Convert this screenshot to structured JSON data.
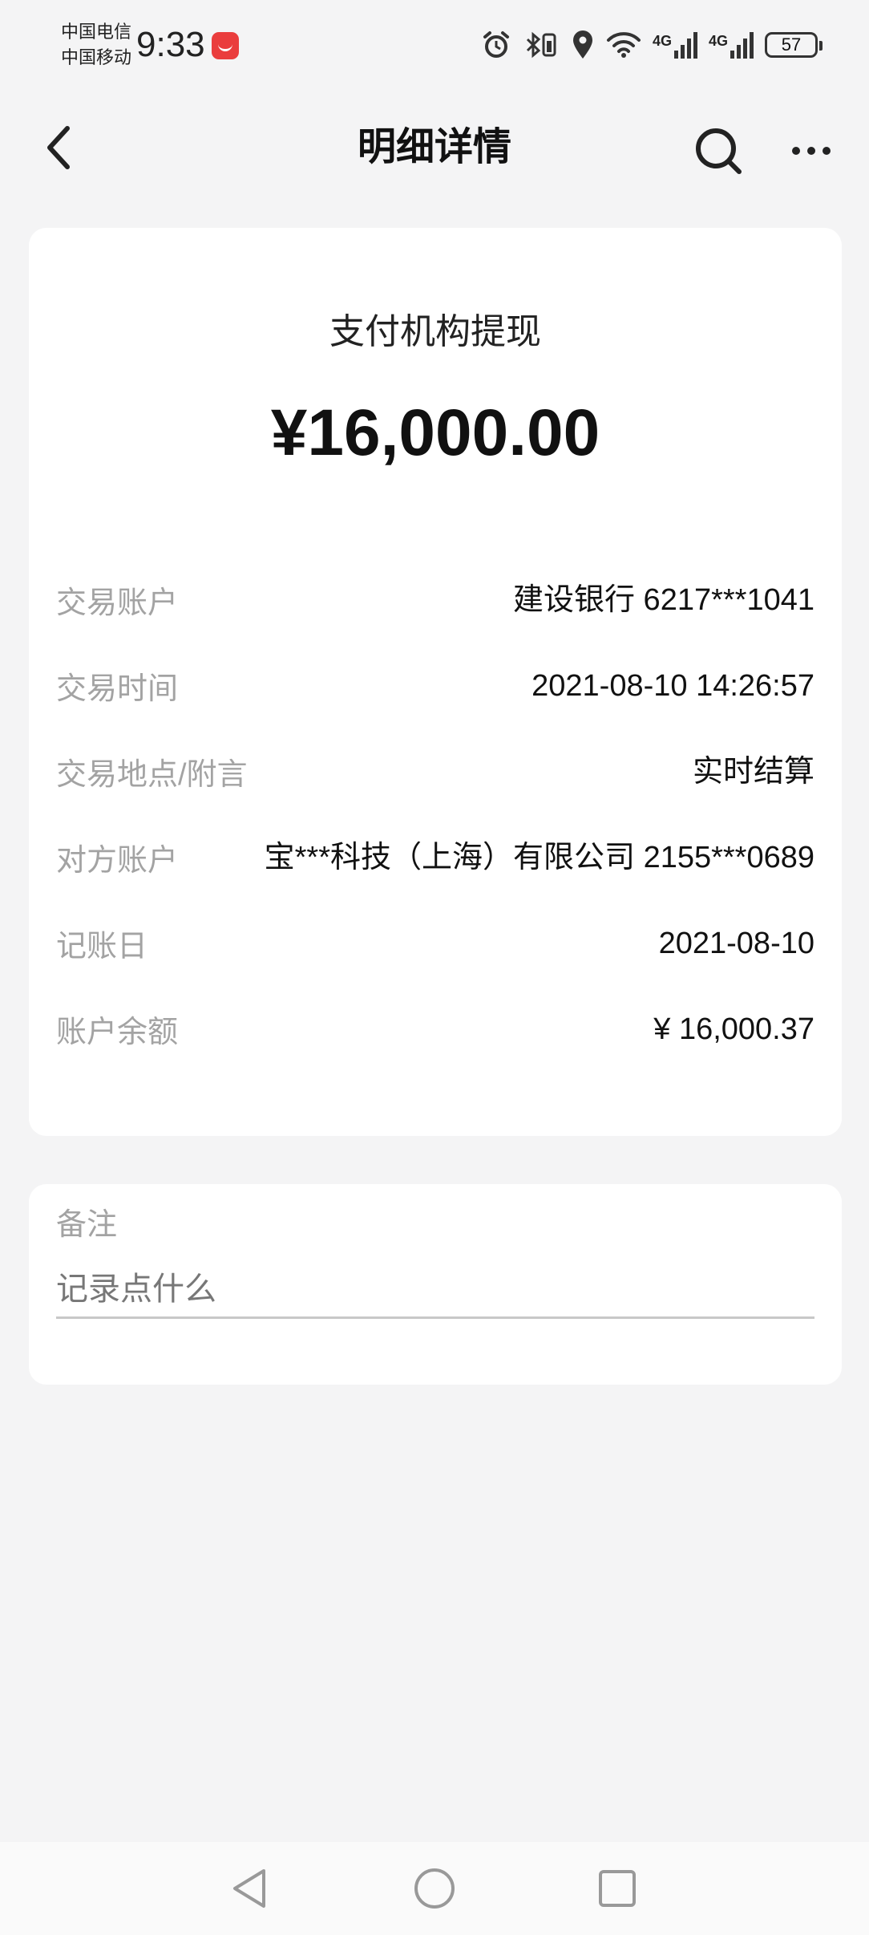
{
  "status_bar": {
    "carrier_1": "中国电信",
    "carrier_2": "中国移动",
    "time": "9:33",
    "network_1": "4G",
    "network_2": "4G",
    "battery": "57"
  },
  "header": {
    "title": "明细详情"
  },
  "summary": {
    "type": "支付机构提现",
    "amount": "¥16,000.00"
  },
  "details": [
    {
      "label": "交易账户",
      "value": "建设银行 6217***1041"
    },
    {
      "label": "交易时间",
      "value": "2021-08-10 14:26:57"
    },
    {
      "label": "交易地点/附言",
      "value": "实时结算"
    },
    {
      "label": "对方账户",
      "value": "宝***科技（上海）有限公司 2155***0689"
    },
    {
      "label": "记账日",
      "value": "2021-08-10"
    },
    {
      "label": "账户余额",
      "value": "¥ 16,000.37"
    }
  ],
  "remark": {
    "label": "备注",
    "placeholder": "记录点什么"
  },
  "icons": {
    "back": "chevron-left-icon",
    "search": "search-icon",
    "more": "more-dots-icon"
  },
  "colors": {
    "background": "#f4f4f5",
    "card": "#ffffff",
    "label": "#a3a3a3",
    "text": "#111111"
  }
}
